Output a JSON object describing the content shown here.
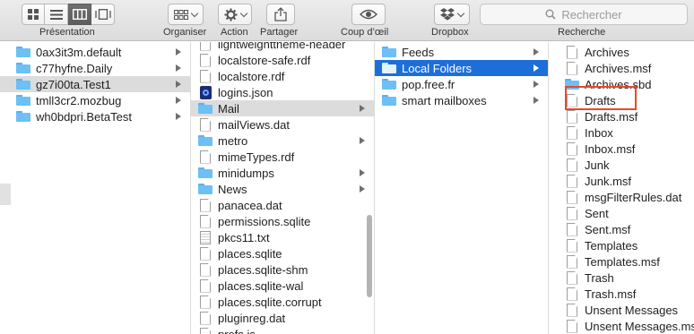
{
  "toolbar": {
    "view_label": "Présentation",
    "arrange_label": "Organiser",
    "action_label": "Action",
    "share_label": "Partager",
    "quicklook_label": "Coup d’œil",
    "dropbox_label": "Dropbox",
    "search_label": "Recherche",
    "search_placeholder": "Rechercher"
  },
  "columns": {
    "col1": [
      {
        "name": "0ax3it3m.default",
        "type": "folder",
        "arrow": true
      },
      {
        "name": "c77hyfne.Daily",
        "type": "folder",
        "arrow": true
      },
      {
        "name": "gz7i00ta.Test1",
        "type": "folder",
        "arrow": true,
        "selected": "gray"
      },
      {
        "name": "tmll3cr2.mozbug",
        "type": "folder",
        "arrow": true
      },
      {
        "name": "wh0bdpri.BetaTest",
        "type": "folder",
        "arrow": true
      }
    ],
    "col2": [
      {
        "name": "lightweighttheme-header",
        "type": "doc"
      },
      {
        "name": "localstore-safe.rdf",
        "type": "doc"
      },
      {
        "name": "localstore.rdf",
        "type": "doc"
      },
      {
        "name": "logins.json",
        "type": "json"
      },
      {
        "name": "Mail",
        "type": "folder",
        "arrow": true,
        "selected": "gray"
      },
      {
        "name": "mailViews.dat",
        "type": "doc"
      },
      {
        "name": "metro",
        "type": "folder",
        "arrow": true
      },
      {
        "name": "mimeTypes.rdf",
        "type": "doc"
      },
      {
        "name": "minidumps",
        "type": "folder",
        "arrow": true
      },
      {
        "name": "News",
        "type": "folder",
        "arrow": true
      },
      {
        "name": "panacea.dat",
        "type": "doc"
      },
      {
        "name": "permissions.sqlite",
        "type": "doc"
      },
      {
        "name": "pkcs11.txt",
        "type": "txt"
      },
      {
        "name": "places.sqlite",
        "type": "doc"
      },
      {
        "name": "places.sqlite-shm",
        "type": "doc"
      },
      {
        "name": "places.sqlite-wal",
        "type": "doc"
      },
      {
        "name": "places.sqlite.corrupt",
        "type": "doc"
      },
      {
        "name": "pluginreg.dat",
        "type": "doc"
      },
      {
        "name": "prefs.js",
        "type": "doc"
      }
    ],
    "col3": [
      {
        "name": "Feeds",
        "type": "folder",
        "arrow": true
      },
      {
        "name": "Local Folders",
        "type": "folder",
        "arrow": true,
        "selected": "blue"
      },
      {
        "name": "pop.free.fr",
        "type": "folder",
        "arrow": true
      },
      {
        "name": "smart mailboxes",
        "type": "folder",
        "arrow": true
      }
    ],
    "col4": [
      {
        "name": "Archives",
        "type": "doc"
      },
      {
        "name": "Archives.msf",
        "type": "doc"
      },
      {
        "name": "Archives.sbd",
        "type": "folder"
      },
      {
        "name": "Drafts",
        "type": "doc"
      },
      {
        "name": "Drafts.msf",
        "type": "doc"
      },
      {
        "name": "Inbox",
        "type": "doc"
      },
      {
        "name": "Inbox.msf",
        "type": "doc"
      },
      {
        "name": "Junk",
        "type": "doc"
      },
      {
        "name": "Junk.msf",
        "type": "doc"
      },
      {
        "name": "msgFilterRules.dat",
        "type": "doc"
      },
      {
        "name": "Sent",
        "type": "doc"
      },
      {
        "name": "Sent.msf",
        "type": "doc"
      },
      {
        "name": "Templates",
        "type": "doc"
      },
      {
        "name": "Templates.msf",
        "type": "doc"
      },
      {
        "name": "Trash",
        "type": "doc"
      },
      {
        "name": "Trash.msf",
        "type": "doc"
      },
      {
        "name": "Unsent Messages",
        "type": "doc"
      },
      {
        "name": "Unsent Messages.msf",
        "type": "doc"
      }
    ]
  },
  "colors": {
    "selection_blue": "#1c6fd9",
    "selection_gray": "#dcdcdc",
    "highlight_red": "#e8492a",
    "folder_blue": "#6cc0f5"
  }
}
